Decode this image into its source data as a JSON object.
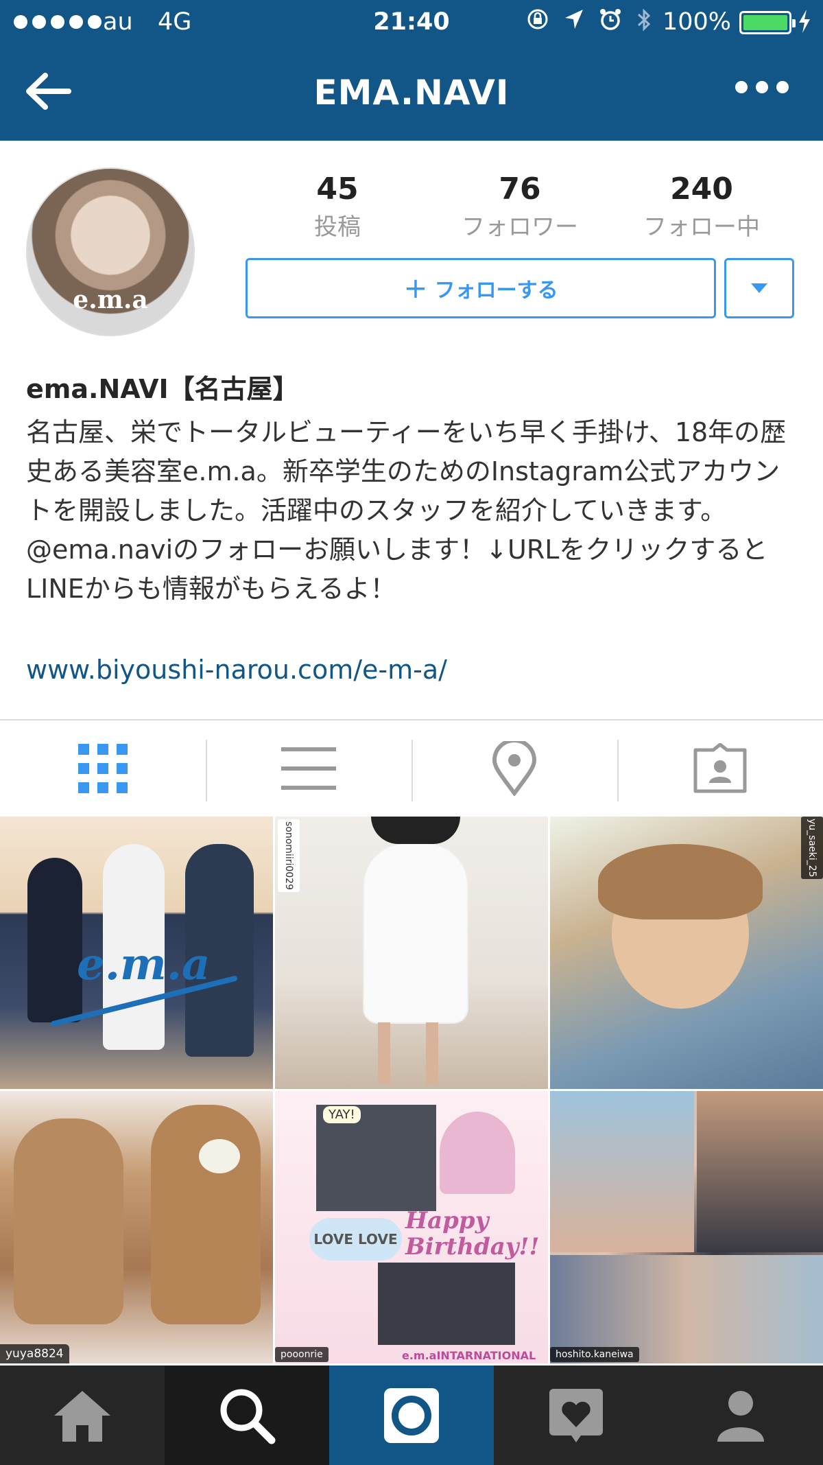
{
  "status": {
    "carrier": "au",
    "network": "4G",
    "time": "21:40",
    "battery_percent": "100%",
    "battery_level": 1.0,
    "icons": [
      "rotation-lock-icon",
      "location-arrow-icon",
      "alarm-icon",
      "bluetooth-icon"
    ]
  },
  "nav": {
    "title": "EMA.NAVI"
  },
  "profile": {
    "avatar_text": "e.m.a",
    "stats": [
      {
        "value": "45",
        "label": "投稿"
      },
      {
        "value": "76",
        "label": "フォロワー"
      },
      {
        "value": "240",
        "label": "フォロー中"
      }
    ],
    "follow_label": "フォローする",
    "name": "ema.NAVI【名古屋】",
    "bio": "名古屋、栄でトータルビューティーをいち早く手掛け、18年の歴史ある美容室e.m.a。新卒学生のためのInstagram公式アカウントを開設しました。活躍中のスタッフを紹介していきます。@ema.naviのフォローお願いします！↓URLをクリックするとLINEからも情報がもらえるよ！",
    "link": "www.biyoushi-narou.com/e-m-a/"
  },
  "tabs": [
    "grid-icon",
    "list-icon",
    "location-pin-icon",
    "tagged-photos-icon"
  ],
  "grid": {
    "posts": [
      {
        "overlay": "e.m.a",
        "tag": ""
      },
      {
        "overlay": "",
        "tag": "sonomiiri0029"
      },
      {
        "overlay": "",
        "tag": "yu_saeki_25"
      },
      {
        "overlay": "",
        "tag": "yuya8824"
      },
      {
        "overlay": "Happy Birthday!!",
        "sub": "LOVE LOVE",
        "top": "YAY!",
        "tag": "pooonrie",
        "bottom_text": "e.m.aINTARNATIONAL"
      },
      {
        "overlay": "",
        "tag": "hoshito.kaneiwa"
      }
    ]
  },
  "bottom_nav": [
    "home-icon",
    "search-icon",
    "camera-icon",
    "activity-icon",
    "profile-icon"
  ],
  "colors": {
    "header": "#125688",
    "accent": "#3897f0",
    "battery": "#4cd964",
    "bottom_bar": "#262626"
  }
}
